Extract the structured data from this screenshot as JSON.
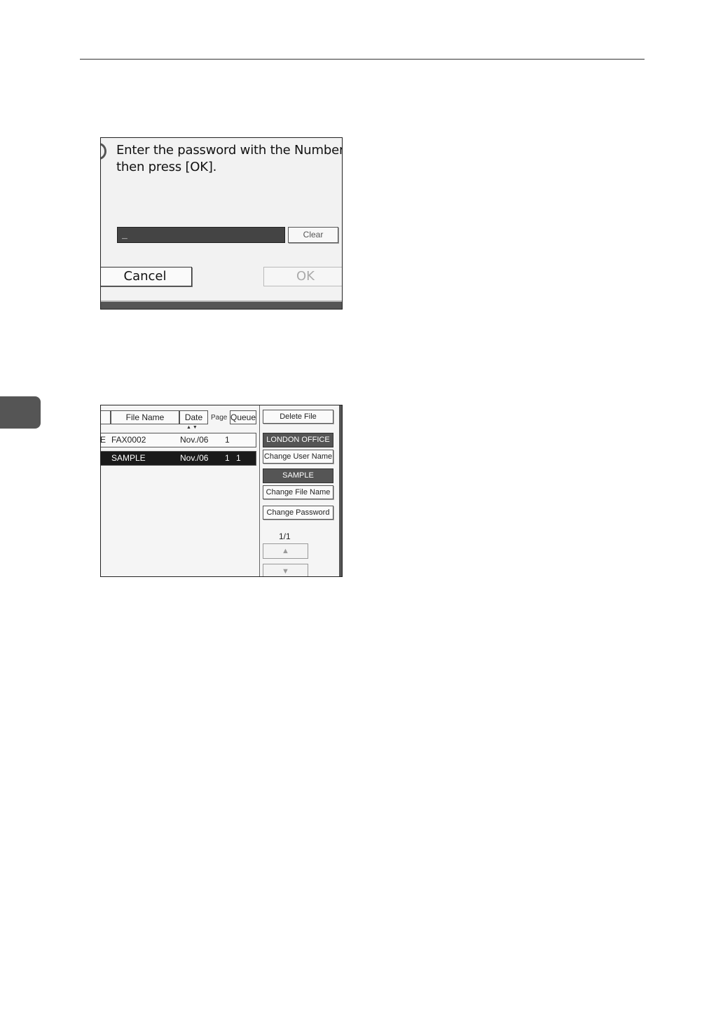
{
  "dialog": {
    "prompt": "Enter the password with the Number keys,\nthen press [OK].",
    "input_value": "_",
    "clear_label": "Clear",
    "cancel_label": "Cancel",
    "ok_label": "OK"
  },
  "file_list": {
    "columns": {
      "file_name": "File Name",
      "date": "Date",
      "page": "Page",
      "queue": "Queue"
    },
    "rows": [
      {
        "prefix": "E",
        "name": "FAX0002",
        "date": "Nov./06",
        "page": "1",
        "queue": ""
      },
      {
        "prefix": "",
        "name": "SAMPLE",
        "date": "Nov./06",
        "page": "1",
        "queue": "1"
      }
    ],
    "side": {
      "delete_file": "Delete File",
      "user_name": "LONDON OFFICE",
      "change_user_name": "Change User Name",
      "file_name": "SAMPLE",
      "change_file_name": "Change File Name",
      "change_password": "Change Password",
      "page_count": "1/1"
    },
    "icons": {
      "scroll_up": "triangle-up-icon",
      "scroll_down": "triangle-down-icon",
      "sort": "sort-arrows-icon"
    }
  }
}
